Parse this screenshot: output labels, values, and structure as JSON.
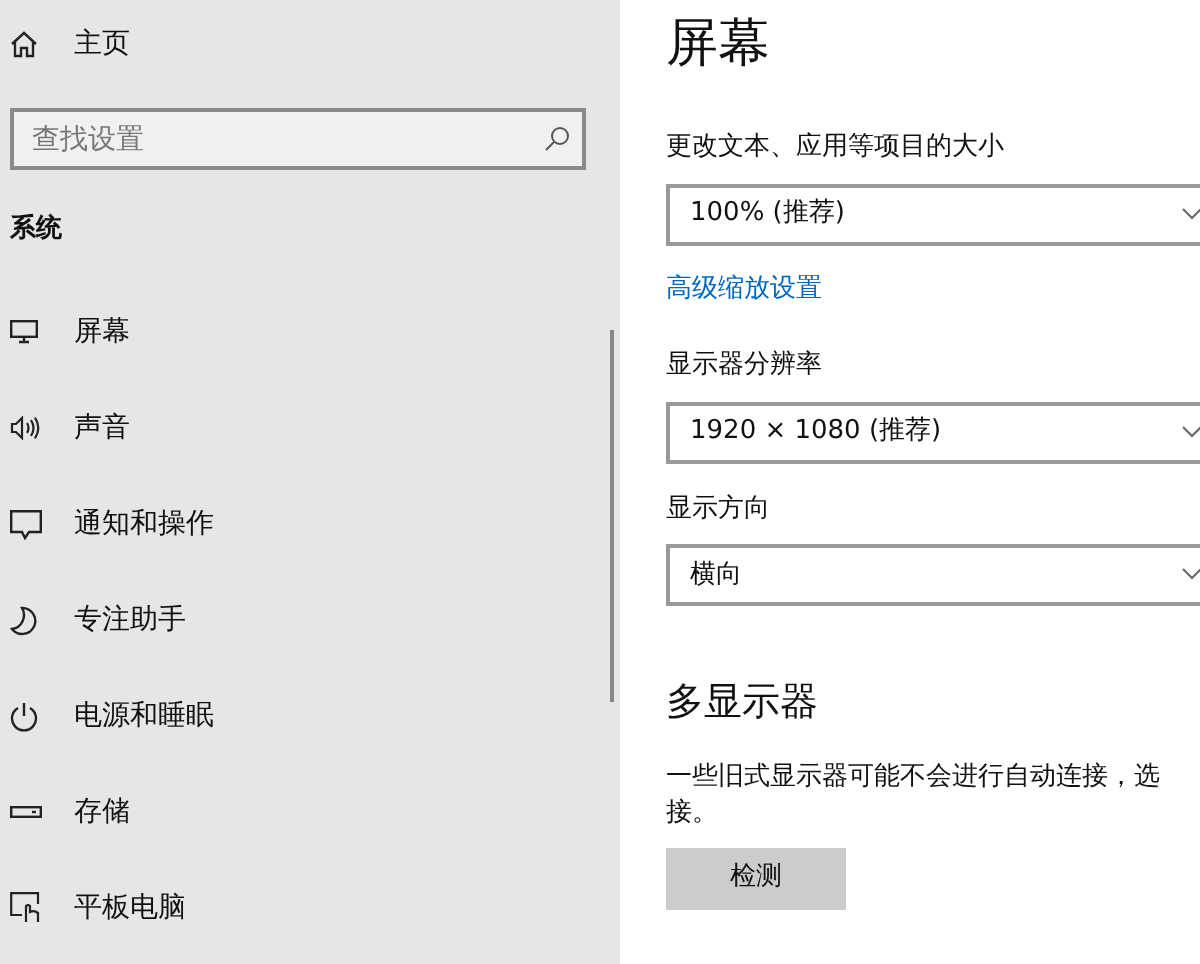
{
  "sidebar": {
    "home": {
      "label": "主页"
    },
    "search": {
      "placeholder": "查找设置"
    },
    "section": "系统",
    "items": [
      {
        "kind": "display",
        "label": "屏幕"
      },
      {
        "kind": "sound",
        "label": "声音"
      },
      {
        "kind": "notifications",
        "label": "通知和操作"
      },
      {
        "kind": "focus",
        "label": "专注助手"
      },
      {
        "kind": "power",
        "label": "电源和睡眠"
      },
      {
        "kind": "storage",
        "label": "存储"
      },
      {
        "kind": "tablet",
        "label": "平板电脑"
      }
    ]
  },
  "main": {
    "title": "屏幕",
    "scale": {
      "label": "更改文本、应用等项目的大小",
      "value": "100% (推荐)"
    },
    "advanced_link": "高级缩放设置",
    "resolution": {
      "label": "显示器分辨率",
      "value": "1920 × 1080 (推荐)"
    },
    "orientation": {
      "label": "显示方向",
      "value": "横向"
    },
    "multi_display": {
      "heading": "多显示器",
      "lines": [
        "一些旧式显示器可能不会进行自动连接，选",
        "接。"
      ],
      "button": "检测"
    }
  }
}
